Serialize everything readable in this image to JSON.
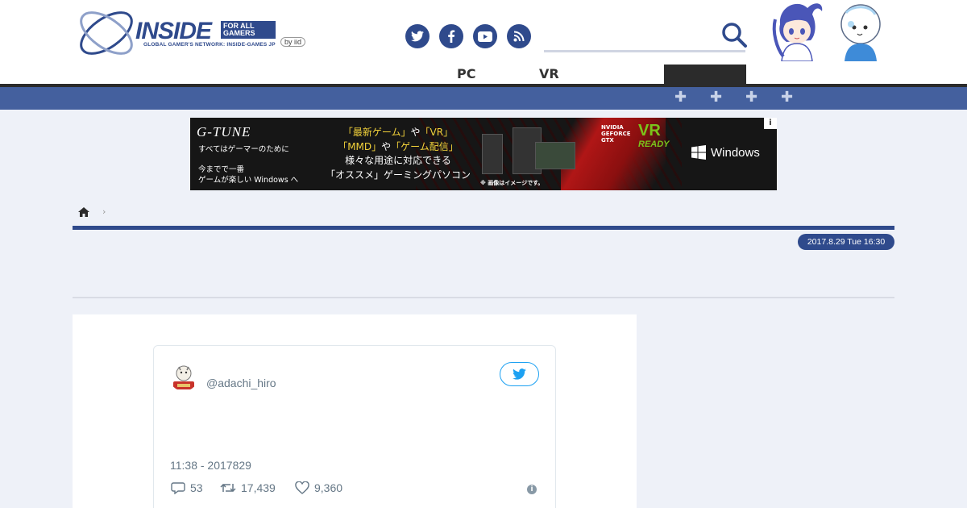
{
  "site": {
    "logo_word": "INSIDE",
    "logo_for": "FOR ALL GAMERS",
    "logo_tagline": "GLOBAL GAMER'S NETWORK: INSIDE-GAMES JP",
    "logo_by": "by iid"
  },
  "social": [
    {
      "name": "twitter-icon"
    },
    {
      "name": "facebook-icon"
    },
    {
      "name": "youtube-icon"
    },
    {
      "name": "rss-icon"
    }
  ],
  "nav": {
    "items": [
      "PC",
      "VR"
    ]
  },
  "ad": {
    "brand": "G-TUNE",
    "left_line1": "すべてはゲーマーのために",
    "left_line2": "今までで一番",
    "left_line3": "ゲームが楽しい Windows へ",
    "mid_line1_a": "「最新ゲーム」",
    "mid_line1_b": "や",
    "mid_line1_c": "「VR」",
    "mid_line2_a": "「MMD」",
    "mid_line2_b": "や",
    "mid_line2_c": "「ゲーム配信」",
    "mid_line3": "様々な用途に対応できる",
    "mid_line4": "「オススメ」ゲーミングパソコン",
    "note": "※ 画像はイメージです。",
    "gpu_line1": "NVIDIA",
    "gpu_line2": "GEFORCE",
    "gpu_line3": "GTX",
    "vr": "VR",
    "ready": "READY",
    "windows": "Windows",
    "info": "i"
  },
  "breadcrumb": {
    "sep": "›"
  },
  "article": {
    "date": "2017.8.29 Tue 16:30"
  },
  "tweet": {
    "handle": "@adachi_hiro",
    "time": "11:38 - 2017829",
    "replies": "53",
    "retweets": "17,439",
    "likes": "9,360"
  },
  "colors": {
    "brand": "#2f4a8c",
    "subbar": "#44609e",
    "twitter": "#1da1f2"
  }
}
